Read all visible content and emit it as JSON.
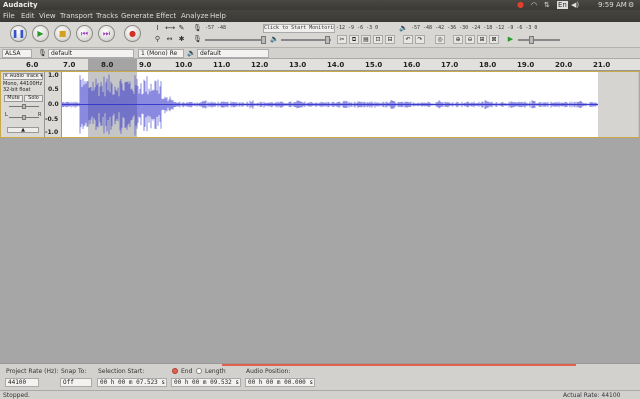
{
  "window": {
    "title": "Audacity"
  },
  "panel_indicators": {
    "keyboard": "En",
    "time": "9:59 AM"
  },
  "menu": [
    "File",
    "Edit",
    "View",
    "Transport",
    "Tracks",
    "Generate",
    "Effect",
    "Analyze",
    "Help"
  ],
  "meters": {
    "record_ticks": "-57   -48",
    "record_prompt": "Click to Start Monitoring",
    "record_ticks_right": "-12  -9  -6  -3  0",
    "play_ticks": "-57   -48   -42   -36   -30   -24   -18   -12   -9   -6   -3   0",
    "record_label_tail": "B"
  },
  "device": {
    "host": "ALSA",
    "recording_device": "default",
    "channels": "1 (Mono) Re",
    "playback_device": "default"
  },
  "ruler": {
    "ticks": [
      "6.0",
      "7.0",
      "8.0",
      "9.0",
      "10.0",
      "11.0",
      "12.0",
      "13.0",
      "14.0",
      "15.0",
      "16.0",
      "17.0",
      "18.0",
      "19.0",
      "20.0",
      "21.0"
    ]
  },
  "track": {
    "name": "Audio Track",
    "info1": "Mono, 44100Hz",
    "info2": "32-bit float",
    "mute": "Mute",
    "solo": "Solo",
    "pan_left": "L",
    "pan_right": "R",
    "scale": [
      "1.0",
      "0.5",
      "0.0",
      "-0.5",
      "-1.0"
    ]
  },
  "selection_bar": {
    "rate_label": "Project Rate (Hz):",
    "rate_value": "44100",
    "snap_label": "Snap To:",
    "snap_value": "Off",
    "start_label": "Selection Start:",
    "start_value": "00 h 00 m 07.523 s",
    "end_label": "End",
    "length_label": "Length",
    "end_value": "00 h 00 m 09.532 s",
    "audio_pos_label": "Audio Position:",
    "audio_pos_value": "00 h 00 m 00.000 s"
  },
  "status": {
    "left": "Stopped.",
    "right": "Actual Rate: 44100"
  },
  "colors": {
    "waveform": "#3b3bcc",
    "selection": "#c6c6c6",
    "progress": "#e5604a"
  }
}
